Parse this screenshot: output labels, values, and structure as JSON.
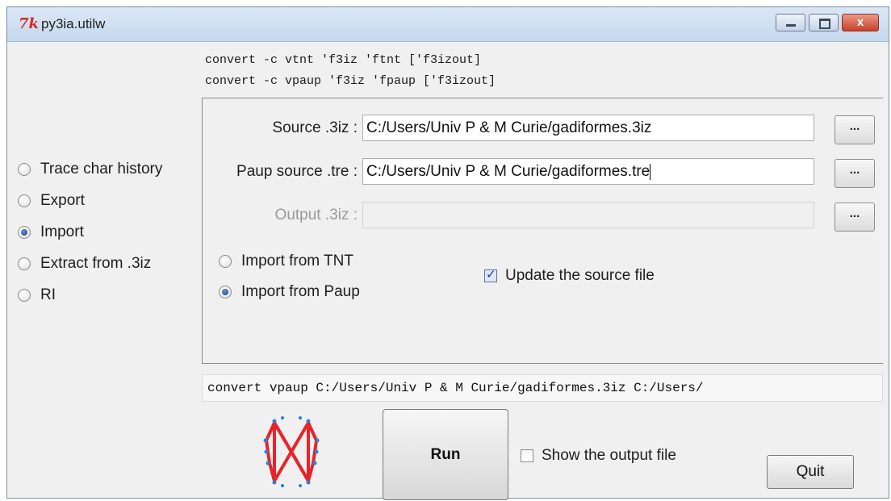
{
  "window": {
    "title": "py3ia.utilw",
    "icon": "tk-feather-icon",
    "close_glyph": "x"
  },
  "commands": [
    "convert -c vtnt 'f3iz 'ftnt ['f3izout]",
    "convert -c vpaup 'f3iz 'fpaup ['f3izout]"
  ],
  "sidebar": {
    "options": [
      {
        "label": "Trace char history",
        "selected": false
      },
      {
        "label": "Export",
        "selected": false
      },
      {
        "label": "Import",
        "selected": true
      },
      {
        "label": "Extract from .3iz",
        "selected": false
      },
      {
        "label": "RI",
        "selected": false
      }
    ]
  },
  "form": {
    "source": {
      "label": "Source .3iz :",
      "value": "C:/Users/Univ P & M Curie/gadiformes.3iz",
      "browse": "..."
    },
    "paup": {
      "label": "Paup source .tre :",
      "value": "C:/Users/Univ P & M Curie/gadiformes.tre",
      "browse": "..."
    },
    "output": {
      "label": "Output .3iz :",
      "value": "",
      "browse": "...",
      "disabled": true
    },
    "import_tnt": {
      "label": "Import from TNT",
      "selected": false
    },
    "import_paup": {
      "label": "Import from Paup",
      "selected": true
    },
    "update_source": {
      "label": "Update the source file",
      "checked": true
    }
  },
  "command_line": "convert vpaup C:/Users/Univ P & M Curie/gadiformes.3iz C:/Users/",
  "actions": {
    "run": "Run",
    "show_output": {
      "label": "Show the output file",
      "checked": false
    },
    "quit": "Quit"
  },
  "colors": {
    "logo": "#e8232a",
    "logo_dots": "#2d7fd3"
  }
}
